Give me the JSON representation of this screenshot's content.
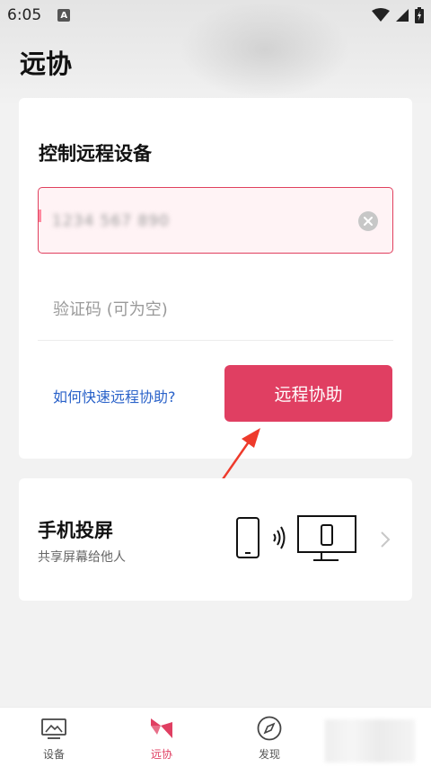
{
  "status_bar": {
    "time": "6:05",
    "notification_badge": "A"
  },
  "page": {
    "title": "远协"
  },
  "control_card": {
    "title": "控制远程设备",
    "device_id_value": "1234 567 890",
    "verify_placeholder": "验证码 (可为空)",
    "help_link": "如何快速远程协助?",
    "assist_button": "远程协助"
  },
  "cast_card": {
    "title": "手机投屏",
    "subtitle": "共享屏幕给他人"
  },
  "bottom_nav": {
    "items": [
      {
        "label": "设备",
        "icon": "device-icon"
      },
      {
        "label": "远协",
        "icon": "remote-assist-icon",
        "active": true
      },
      {
        "label": "发现",
        "icon": "compass-icon"
      }
    ]
  },
  "colors": {
    "accent": "#e03f62",
    "link": "#2a62c9"
  }
}
